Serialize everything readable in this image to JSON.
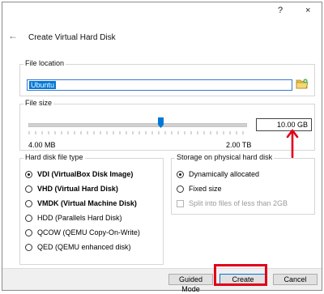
{
  "window": {
    "help_glyph": "?",
    "close_glyph": "×",
    "back_glyph": "←",
    "title": "Create Virtual Hard Disk"
  },
  "file_location": {
    "label": "File location",
    "value": "Ubuntu"
  },
  "file_size": {
    "label": "File size",
    "min_label": "4.00 MB",
    "max_label": "2.00 TB",
    "value": "10.00 GB"
  },
  "disk_type": {
    "label": "Hard disk file type",
    "options": [
      {
        "label": "VDI (VirtualBox Disk Image)",
        "selected": true
      },
      {
        "label": "VHD (Virtual Hard Disk)",
        "selected": false
      },
      {
        "label": "VMDK (Virtual Machine Disk)",
        "selected": false
      },
      {
        "label": "HDD (Parallels Hard Disk)",
        "selected": false
      },
      {
        "label": "QCOW (QEMU Copy-On-Write)",
        "selected": false
      },
      {
        "label": "QED (QEMU enhanced disk)",
        "selected": false
      }
    ]
  },
  "storage": {
    "label": "Storage on physical hard disk",
    "options": [
      {
        "label": "Dynamically allocated",
        "selected": true
      },
      {
        "label": "Fixed size",
        "selected": false
      }
    ],
    "split_label": "Split into files of less than 2GB"
  },
  "buttons": {
    "guided_mode": "Guided Mode",
    "create": "Create",
    "cancel": "Cancel"
  },
  "colors": {
    "highlight": "#e0001a",
    "accent": "#0078d7"
  }
}
